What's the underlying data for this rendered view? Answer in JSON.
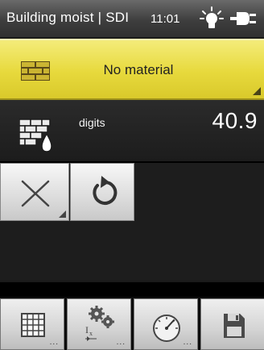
{
  "status_bar": {
    "title": "Building moist",
    "mode": "SDI",
    "time": "11:01",
    "icons": [
      "lightbulb-icon",
      "power-plug-icon"
    ]
  },
  "material": {
    "label": "No material",
    "icon": "brick-wall-icon"
  },
  "reading": {
    "unit_label": "digits",
    "value": "40.9",
    "icon": "wall-moisture-icon"
  },
  "buttons": [
    {
      "name": "cancel",
      "icon": "close-x-icon"
    },
    {
      "name": "refresh",
      "icon": "refresh-icon"
    }
  ],
  "toolbar": [
    {
      "name": "grid",
      "icon": "grid-icon",
      "more": "..."
    },
    {
      "name": "settings",
      "icon": "gears-icon",
      "more": "..."
    },
    {
      "name": "gauge",
      "icon": "gauge-icon",
      "more": "..."
    },
    {
      "name": "save",
      "icon": "floppy-disk-icon",
      "more": ""
    }
  ],
  "colors": {
    "accent_yellow": "#e7d93c",
    "dark_bg": "#1a1a1a",
    "status_bg": "#3e3e3e"
  }
}
